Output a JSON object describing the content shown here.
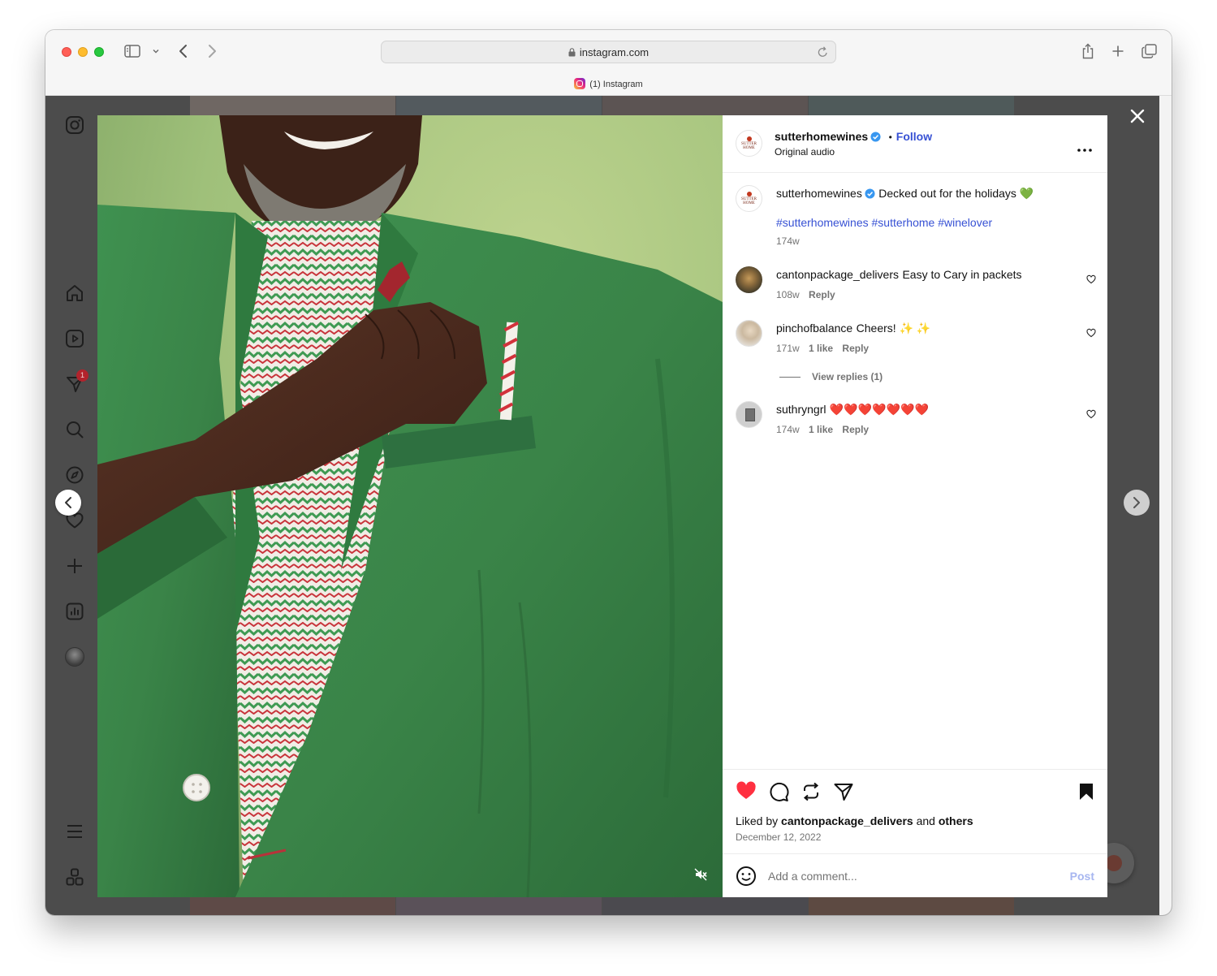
{
  "browser": {
    "url": "instagram.com",
    "tab_title": "(1) Instagram"
  },
  "sidebar": {
    "notifications_badge": "1",
    "icons": [
      "instagram-logo-icon",
      "home-icon",
      "reels-icon",
      "messages-icon",
      "search-icon",
      "explore-icon",
      "heart-icon",
      "create-icon",
      "insights-icon",
      "profile-avatar",
      "menu-icon",
      "apps-icon"
    ]
  },
  "post": {
    "username": "sutterhomewines",
    "follow_label": "Follow",
    "separator": "•",
    "audio": "Original audio",
    "logo_text": "SUTTER HOME",
    "caption_username": "sutterhomewines",
    "caption_text": "Decked out for the holidays 💚",
    "hashtags": "#sutterhomewines #sutterhome #winelover",
    "caption_time": "174w"
  },
  "comments": [
    {
      "username": "cantonpackage_delivers",
      "text": "Easy to Cary in packets",
      "time": "108w",
      "likes": "",
      "reply": "Reply"
    },
    {
      "username": "pinchofbalance",
      "text": "Cheers! ✨ ✨",
      "time": "171w",
      "likes": "1 like",
      "reply": "Reply",
      "view_replies": "View replies (1)"
    },
    {
      "username": "suthryngrl",
      "text": "❤️❤️❤️❤️❤️❤️❤️",
      "time": "174w",
      "likes": "1 like",
      "reply": "Reply"
    }
  ],
  "footer": {
    "liked_prefix": "Liked by",
    "liked_user": "cantonpackage_delivers",
    "liked_and": "and",
    "liked_others": "others",
    "date": "December 12, 2022",
    "comment_placeholder": "Add a comment...",
    "post_label": "Post"
  },
  "colors": {
    "like_red": "#ff3040",
    "link_blue": "#3751d4",
    "jacket_green": "#3f8a4c",
    "background_green": "#a6c77a"
  }
}
